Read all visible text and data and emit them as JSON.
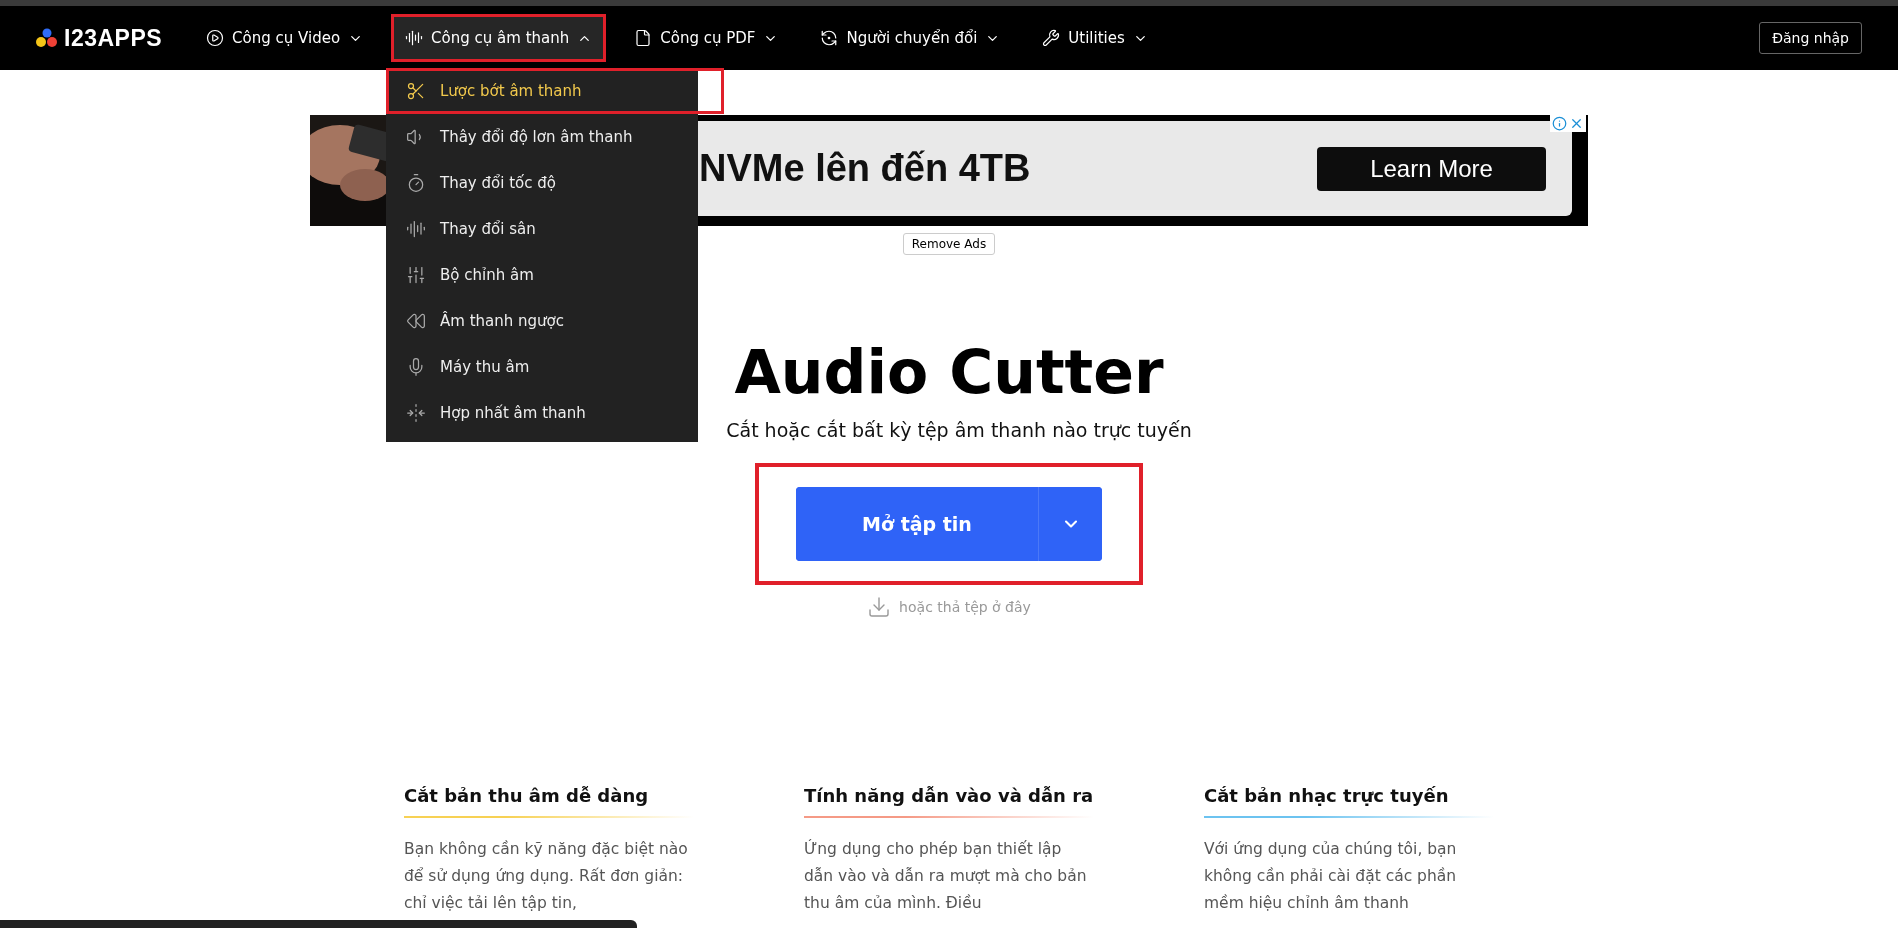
{
  "header": {
    "logo": "I23APPS",
    "nav": [
      {
        "label": "Công cụ Video",
        "expanded": false,
        "highlighted": false
      },
      {
        "label": "Công cụ âm thanh",
        "expanded": true,
        "highlighted": true
      },
      {
        "label": "Công cụ PDF",
        "expanded": false,
        "highlighted": false
      },
      {
        "label": "Người chuyển đổi",
        "expanded": false,
        "highlighted": false
      },
      {
        "label": "Utilities",
        "expanded": false,
        "highlighted": false
      }
    ],
    "login": "Đăng nhập"
  },
  "dropdown": {
    "items": [
      {
        "label": "Lược bớt âm thanh",
        "selected": true,
        "highlighted": true
      },
      {
        "label": "Thây đổi độ lơn âm thanh",
        "selected": false,
        "highlighted": false
      },
      {
        "label": "Thay đổi tốc độ",
        "selected": false,
        "highlighted": false
      },
      {
        "label": "Thay đổi sân",
        "selected": false,
        "highlighted": false
      },
      {
        "label": "Bộ chỉnh âm",
        "selected": false,
        "highlighted": false
      },
      {
        "label": "Âm thanh ngược",
        "selected": false,
        "highlighted": false
      },
      {
        "label": "Máy thu âm",
        "selected": false,
        "highlighted": false
      },
      {
        "label": "Hợp nhất âm thanh",
        "selected": false,
        "highlighted": false
      }
    ]
  },
  "ad": {
    "headline": "NVMe lên đến 4TB",
    "cta": "Learn More",
    "remove": "Remove Ads"
  },
  "hero": {
    "title": "Audio Cutter",
    "subtitle": "Cắt hoặc cắt bất kỳ tệp âm thanh nào trực tuyến",
    "button": "Mở tập tin",
    "highlighted": true,
    "hint": "hoặc thả tệp ở đây"
  },
  "features": [
    {
      "title": "Cắt bản thu âm dễ dàng",
      "color": "#f7d154",
      "text": "Bạn không cần kỹ năng đặc biệt nào để sử dụng ứng dụng. Rất đơn giản: chỉ việc tải lên tập tin,"
    },
    {
      "title": "Tính năng dẫn vào và dẫn ra",
      "color": "#f59a86",
      "text": "Ứng dụng cho phép bạn thiết lập dẫn vào và dẫn ra mượt mà cho bản thu âm của mình. Điều"
    },
    {
      "title": "Cắt bản nhạc trực tuyến",
      "color": "#6cc3f0",
      "text": "Với ứng dụng của chúng tôi, bạn không cần phải cài đặt các phần mềm hiệu chỉnh âm thanh"
    }
  ]
}
